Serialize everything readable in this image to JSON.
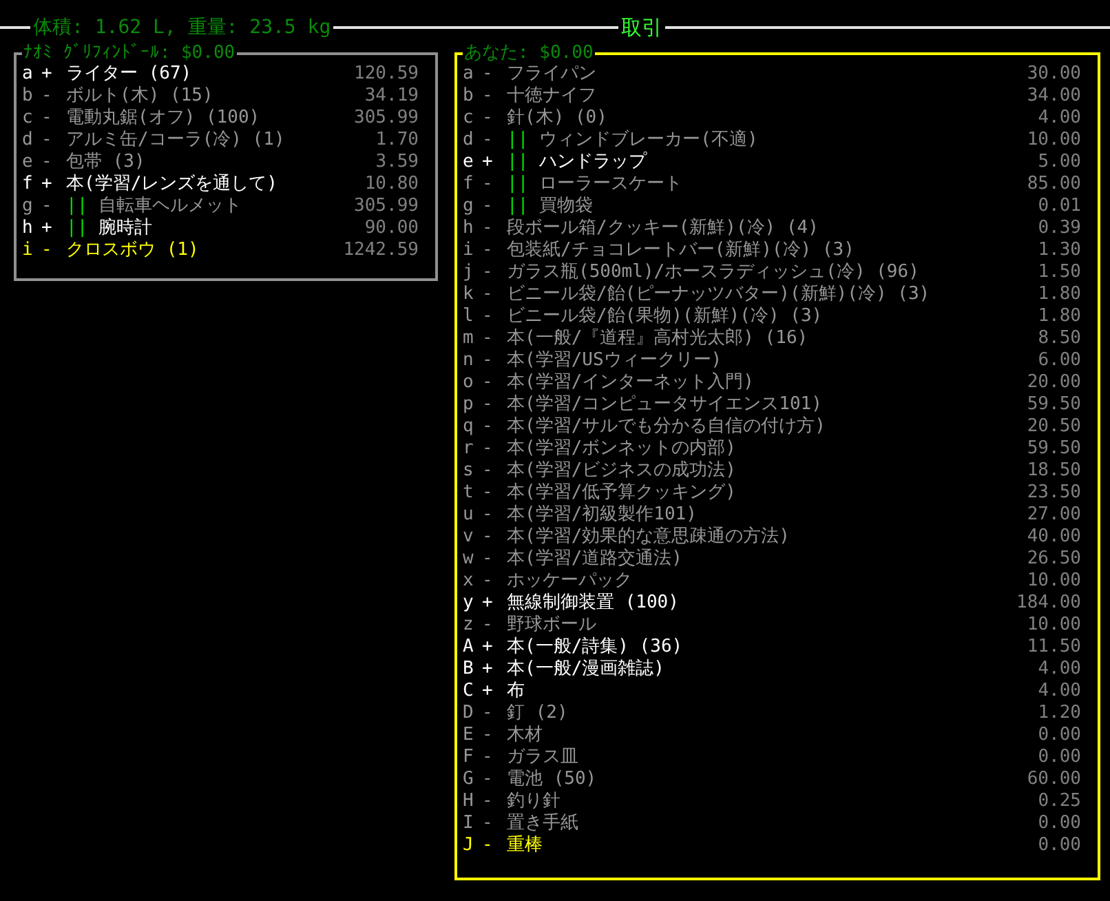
{
  "header": {
    "stats": "体積: 1.62 L, 重量: 23.5 kg",
    "title": "取引"
  },
  "panels": [
    {
      "title": "ﾅｵﾐ ｸﾞﾘﾌｨﾝﾄﾞｰﾙ: $0.00",
      "active": false,
      "rows": [
        {
          "key": "a",
          "marker": "+",
          "name": "ライター (67)",
          "price": "120.59",
          "selected": true,
          "cursor": false
        },
        {
          "key": "b",
          "marker": "-",
          "name": "ボルト(木) (15)",
          "price": "34.19",
          "selected": false,
          "cursor": false
        },
        {
          "key": "c",
          "marker": "-",
          "name": "電動丸鋸(オフ) (100)",
          "price": "305.99",
          "selected": false,
          "cursor": false
        },
        {
          "key": "d",
          "marker": "-",
          "name": "アルミ缶/コーラ(冷) (1)",
          "price": "1.70",
          "selected": false,
          "cursor": false
        },
        {
          "key": "e",
          "marker": "-",
          "name": "包帯 (3)",
          "price": "3.59",
          "selected": false,
          "cursor": false
        },
        {
          "key": "f",
          "marker": "+",
          "name": "本(学習/レンズを通して)",
          "price": "10.80",
          "selected": true,
          "cursor": false
        },
        {
          "key": "g",
          "marker": "-",
          "tag": "||",
          "name": "自転車ヘルメット",
          "price": "305.99",
          "selected": false,
          "cursor": false
        },
        {
          "key": "h",
          "marker": "+",
          "tag": "||",
          "name": "腕時計",
          "price": "90.00",
          "selected": true,
          "cursor": false
        },
        {
          "key": "i",
          "marker": "-",
          "name": "クロスボウ (1)",
          "price": "1242.59",
          "selected": false,
          "cursor": true
        }
      ]
    },
    {
      "title": "あなた: $0.00",
      "active": true,
      "rows": [
        {
          "key": "a",
          "marker": "-",
          "name": "フライパン",
          "price": "30.00",
          "selected": false,
          "cursor": false
        },
        {
          "key": "b",
          "marker": "-",
          "name": "十徳ナイフ",
          "price": "34.00",
          "selected": false,
          "cursor": false
        },
        {
          "key": "c",
          "marker": "-",
          "name": "針(木) (0)",
          "price": "4.00",
          "selected": false,
          "cursor": false
        },
        {
          "key": "d",
          "marker": "-",
          "tag": "||",
          "name": "ウィンドブレーカー(不適)",
          "price": "10.00",
          "selected": false,
          "cursor": false
        },
        {
          "key": "e",
          "marker": "+",
          "tag": "||",
          "name": "ハンドラップ",
          "price": "5.00",
          "selected": true,
          "cursor": false
        },
        {
          "key": "f",
          "marker": "-",
          "tag": "||",
          "name": "ローラースケート",
          "price": "85.00",
          "selected": false,
          "cursor": false
        },
        {
          "key": "g",
          "marker": "-",
          "tag": "||",
          "name": "買物袋",
          "price": "0.01",
          "selected": false,
          "cursor": false
        },
        {
          "key": "h",
          "marker": "-",
          "name": "段ボール箱/クッキー(新鮮)(冷) (4)",
          "price": "0.39",
          "selected": false,
          "cursor": false
        },
        {
          "key": "i",
          "marker": "-",
          "name": "包装紙/チョコレートバー(新鮮)(冷) (3)",
          "price": "1.30",
          "selected": false,
          "cursor": false
        },
        {
          "key": "j",
          "marker": "-",
          "name": "ガラス瓶(500ml)/ホースラディッシュ(冷) (96)",
          "price": "1.50",
          "selected": false,
          "cursor": false
        },
        {
          "key": "k",
          "marker": "-",
          "name": "ビニール袋/飴(ピーナッツバター)(新鮮)(冷) (3)",
          "price": "1.80",
          "selected": false,
          "cursor": false
        },
        {
          "key": "l",
          "marker": "-",
          "name": "ビニール袋/飴(果物)(新鮮)(冷) (3)",
          "price": "1.80",
          "selected": false,
          "cursor": false
        },
        {
          "key": "m",
          "marker": "-",
          "name": "本(一般/『道程』高村光太郎) (16)",
          "price": "8.50",
          "selected": false,
          "cursor": false
        },
        {
          "key": "n",
          "marker": "-",
          "name": "本(学習/USウィークリー)",
          "price": "6.00",
          "selected": false,
          "cursor": false
        },
        {
          "key": "o",
          "marker": "-",
          "name": "本(学習/インターネット入門)",
          "price": "20.00",
          "selected": false,
          "cursor": false
        },
        {
          "key": "p",
          "marker": "-",
          "name": "本(学習/コンピュータサイエンス101)",
          "price": "59.50",
          "selected": false,
          "cursor": false
        },
        {
          "key": "q",
          "marker": "-",
          "name": "本(学習/サルでも分かる自信の付け方)",
          "price": "20.50",
          "selected": false,
          "cursor": false
        },
        {
          "key": "r",
          "marker": "-",
          "name": "本(学習/ボンネットの内部)",
          "price": "59.50",
          "selected": false,
          "cursor": false
        },
        {
          "key": "s",
          "marker": "-",
          "name": "本(学習/ビジネスの成功法)",
          "price": "18.50",
          "selected": false,
          "cursor": false
        },
        {
          "key": "t",
          "marker": "-",
          "name": "本(学習/低予算クッキング)",
          "price": "23.50",
          "selected": false,
          "cursor": false
        },
        {
          "key": "u",
          "marker": "-",
          "name": "本(学習/初級製作101)",
          "price": "27.00",
          "selected": false,
          "cursor": false
        },
        {
          "key": "v",
          "marker": "-",
          "name": "本(学習/効果的な意思疎通の方法)",
          "price": "40.00",
          "selected": false,
          "cursor": false
        },
        {
          "key": "w",
          "marker": "-",
          "name": "本(学習/道路交通法)",
          "price": "26.50",
          "selected": false,
          "cursor": false
        },
        {
          "key": "x",
          "marker": "-",
          "name": "ホッケーパック",
          "price": "10.00",
          "selected": false,
          "cursor": false
        },
        {
          "key": "y",
          "marker": "+",
          "name": "無線制御装置 (100)",
          "price": "184.00",
          "selected": true,
          "cursor": false
        },
        {
          "key": "z",
          "marker": "-",
          "name": "野球ボール",
          "price": "10.00",
          "selected": false,
          "cursor": false
        },
        {
          "key": "A",
          "marker": "+",
          "name": "本(一般/詩集) (36)",
          "price": "11.50",
          "selected": true,
          "cursor": false
        },
        {
          "key": "B",
          "marker": "+",
          "name": "本(一般/漫画雑誌)",
          "price": "4.00",
          "selected": true,
          "cursor": false
        },
        {
          "key": "C",
          "marker": "+",
          "name": "布",
          "price": "4.00",
          "selected": true,
          "cursor": false
        },
        {
          "key": "D",
          "marker": "-",
          "name": "釘 (2)",
          "price": "1.20",
          "selected": false,
          "cursor": false
        },
        {
          "key": "E",
          "marker": "-",
          "name": "木材",
          "price": "0.00",
          "selected": false,
          "cursor": false
        },
        {
          "key": "F",
          "marker": "-",
          "name": "ガラス皿",
          "price": "0.00",
          "selected": false,
          "cursor": false
        },
        {
          "key": "G",
          "marker": "-",
          "name": "電池 (50)",
          "price": "60.00",
          "selected": false,
          "cursor": false
        },
        {
          "key": "H",
          "marker": "-",
          "name": "釣り針",
          "price": "0.25",
          "selected": false,
          "cursor": false
        },
        {
          "key": "I",
          "marker": "-",
          "name": "置き手紙",
          "price": "0.00",
          "selected": false,
          "cursor": false
        },
        {
          "key": "J",
          "marker": "-",
          "name": "重棒",
          "price": "0.00",
          "selected": false,
          "cursor": true
        }
      ]
    }
  ]
}
